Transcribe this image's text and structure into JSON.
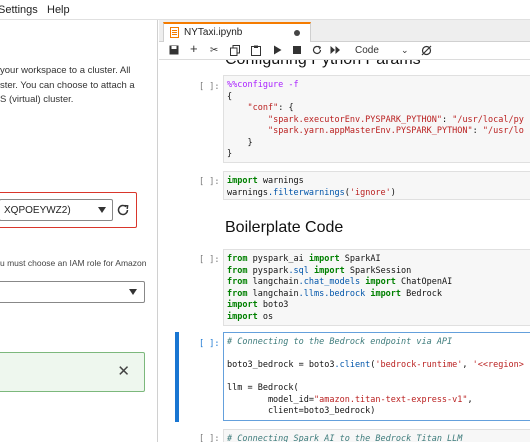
{
  "menu": {
    "items": [
      "Settings",
      "Help"
    ]
  },
  "left_panel": {
    "description_lines": [
      "your workspace to a cluster. All",
      "ster. You can choose to attach a",
      "S (virtual) cluster."
    ],
    "cluster_select_value": "XQPOEYWZ2)",
    "iam_note": "u must choose an IAM role for Amazon",
    "role_select_value": "",
    "colors": {
      "error_border": "#d9362b",
      "success_border": "#7cb87c",
      "success_bg": "#eef7ee"
    }
  },
  "notebook": {
    "tab_title": "NYTaxi.ipynb",
    "kernel": "Code",
    "toolbar_icons": [
      "save-icon",
      "add-cell-icon",
      "cut-icon",
      "copy-icon",
      "paste-icon",
      "run-icon",
      "stop-icon",
      "restart-icon",
      "fast-forward-icon",
      "chevron-down-icon",
      "git-icon"
    ],
    "heading_top": "Configuring Python Params",
    "cells": [
      {
        "prompt": "[ ]:",
        "lines": [
          [
            [
              "mg",
              "%%configure -f"
            ]
          ],
          [
            [
              "",
              "{"
            ]
          ],
          [
            [
              "",
              "    "
            ],
            [
              "st",
              "\"conf\""
            ],
            [
              "",
              ": {"
            ]
          ],
          [
            [
              "",
              "        "
            ],
            [
              "st",
              "\"spark.executorEnv.PYSPARK_PYTHON\""
            ],
            [
              "",
              ": "
            ],
            [
              "st",
              "\"/usr/local/py"
            ]
          ],
          [
            [
              "",
              "        "
            ],
            [
              "st",
              "\"spark.yarn.appMasterEnv.PYSPARK_PYTHON\""
            ],
            [
              "",
              ": "
            ],
            [
              "st",
              "\"/usr/lo"
            ]
          ],
          [
            [
              "",
              "    }"
            ]
          ],
          [
            [
              "",
              "}"
            ]
          ]
        ]
      },
      {
        "prompt": "[ ]:",
        "lines": [
          [
            [
              "kw",
              "import"
            ],
            [
              "",
              " warnings"
            ]
          ],
          [
            [
              "",
              "warnings"
            ],
            [
              "mt",
              ".filterwarnings"
            ],
            [
              "",
              "("
            ],
            [
              "st",
              "'ignore'"
            ],
            [
              "",
              ")"
            ]
          ]
        ]
      },
      {
        "prompt": "[ ]:",
        "lines": [
          [
            [
              "kw",
              "from"
            ],
            [
              "",
              " pyspark_ai "
            ],
            [
              "kw",
              "import"
            ],
            [
              "",
              " SparkAI"
            ]
          ],
          [
            [
              "kw",
              "from"
            ],
            [
              "",
              " pyspark"
            ],
            [
              "mt",
              ".sql"
            ],
            [
              "",
              " "
            ],
            [
              "kw",
              "import"
            ],
            [
              "",
              " SparkSession"
            ]
          ],
          [
            [
              "kw",
              "from"
            ],
            [
              "",
              " langchain"
            ],
            [
              "mt",
              ".chat_models"
            ],
            [
              "",
              " "
            ],
            [
              "kw",
              "import"
            ],
            [
              "",
              " ChatOpenAI"
            ]
          ],
          [
            [
              "kw",
              "from"
            ],
            [
              "",
              " langchain"
            ],
            [
              "mt",
              ".llms.bedrock"
            ],
            [
              "",
              " "
            ],
            [
              "kw",
              "import"
            ],
            [
              "",
              " Bedrock"
            ]
          ],
          [
            [
              "kw",
              "import"
            ],
            [
              "",
              " boto3"
            ]
          ],
          [
            [
              "kw",
              "import"
            ],
            [
              "",
              " os"
            ]
          ]
        ]
      },
      {
        "prompt": "[ ]:",
        "lines": [
          [
            [
              "cm",
              "# Connecting to the Bedrock endpoint via API"
            ]
          ],
          [
            [
              "",
              ""
            ]
          ],
          [
            [
              "",
              "boto3_bedrock = boto3"
            ],
            [
              "mt",
              ".client"
            ],
            [
              "",
              "("
            ],
            [
              "st",
              "'bedrock-runtime'"
            ],
            [
              "",
              ", "
            ],
            [
              "st",
              "'<<region>"
            ]
          ],
          [
            [
              "",
              ""
            ]
          ],
          [
            [
              "",
              "llm = Bedrock("
            ]
          ],
          [
            [
              "",
              "        model_id="
            ],
            [
              "st",
              "\"amazon.titan-text-express-v1\""
            ],
            [
              "",
              ","
            ]
          ],
          [
            [
              "",
              "        client=boto3_bedrock)"
            ]
          ]
        ]
      },
      {
        "prompt": "[ ]:",
        "lines": [
          [
            [
              "cm",
              "# Connecting Spark AI to the Bedrock Titan LLM"
            ]
          ]
        ]
      }
    ],
    "heading_boilerplate": "Boilerplate Code"
  }
}
